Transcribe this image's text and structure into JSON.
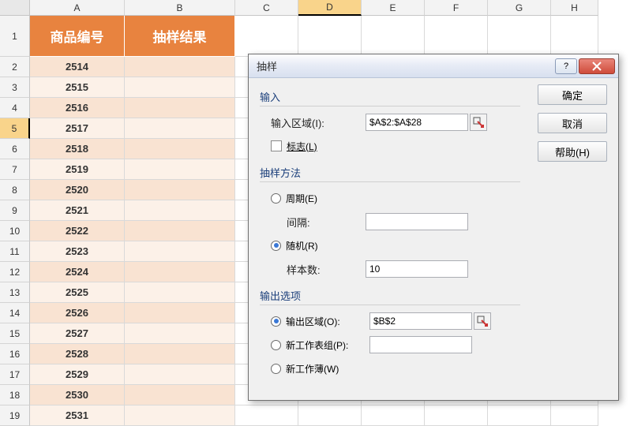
{
  "columns": [
    {
      "name": "A",
      "w": 120
    },
    {
      "name": "B",
      "w": 140
    },
    {
      "name": "C",
      "w": 80
    },
    {
      "name": "D",
      "w": 80,
      "sel": true
    },
    {
      "name": "E",
      "w": 80
    },
    {
      "name": "F",
      "w": 80
    },
    {
      "name": "G",
      "w": 80
    },
    {
      "name": "H",
      "w": 60
    }
  ],
  "header_row": {
    "a": "商品编号",
    "b": "抽样结果"
  },
  "rows": [
    {
      "n": 2,
      "a": "2514"
    },
    {
      "n": 3,
      "a": "2515"
    },
    {
      "n": 4,
      "a": "2516"
    },
    {
      "n": 5,
      "a": "2517",
      "sel": true
    },
    {
      "n": 6,
      "a": "2518"
    },
    {
      "n": 7,
      "a": "2519"
    },
    {
      "n": 8,
      "a": "2520"
    },
    {
      "n": 9,
      "a": "2521"
    },
    {
      "n": 10,
      "a": "2522"
    },
    {
      "n": 11,
      "a": "2523"
    },
    {
      "n": 12,
      "a": "2524"
    },
    {
      "n": 13,
      "a": "2525"
    },
    {
      "n": 14,
      "a": "2526"
    },
    {
      "n": 15,
      "a": "2527"
    },
    {
      "n": 16,
      "a": "2528"
    },
    {
      "n": 17,
      "a": "2529"
    },
    {
      "n": 18,
      "a": "2530"
    },
    {
      "n": 19,
      "a": "2531"
    }
  ],
  "dialog": {
    "title": "抽样",
    "buttons": {
      "ok": "确定",
      "cancel": "取消",
      "help": "帮助(H)"
    },
    "input": {
      "group": "输入",
      "range_label": "输入区域(I):",
      "range_value": "$A$2:$A$28",
      "flags_label": "标志(L)"
    },
    "method": {
      "group": "抽样方法",
      "periodic": "周期(E)",
      "interval": "间隔:",
      "random": "随机(R)",
      "samples": "样本数:",
      "samples_value": "10"
    },
    "output": {
      "group": "输出选项",
      "range": "输出区域(O):",
      "range_value": "$B$2",
      "new_sheet": "新工作表组(P):",
      "new_book": "新工作薄(W)"
    }
  }
}
